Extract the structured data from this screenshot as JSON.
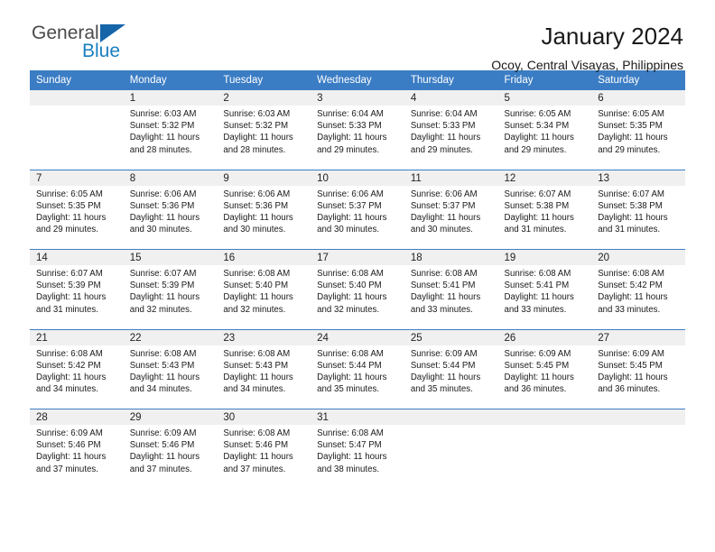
{
  "logo": {
    "word1": "General",
    "word2": "Blue",
    "triangle_color": "#1565a8",
    "blue_color": "#1a7fc1"
  },
  "header": {
    "title": "January 2024",
    "subtitle": "Ocoy, Central Visayas, Philippines"
  },
  "theme": {
    "header_bg": "#3b7dc4",
    "daynum_bg": "#f0f0f0",
    "cell_bg": "#ffffff"
  },
  "weekdays": [
    "Sunday",
    "Monday",
    "Tuesday",
    "Wednesday",
    "Thursday",
    "Friday",
    "Saturday"
  ],
  "weeks": [
    {
      "days": [
        {
          "num": "",
          "sunrise": "",
          "sunset": "",
          "daylight1": "",
          "daylight2": ""
        },
        {
          "num": "1",
          "sunrise": "Sunrise: 6:03 AM",
          "sunset": "Sunset: 5:32 PM",
          "daylight1": "Daylight: 11 hours",
          "daylight2": "and 28 minutes."
        },
        {
          "num": "2",
          "sunrise": "Sunrise: 6:03 AM",
          "sunset": "Sunset: 5:32 PM",
          "daylight1": "Daylight: 11 hours",
          "daylight2": "and 28 minutes."
        },
        {
          "num": "3",
          "sunrise": "Sunrise: 6:04 AM",
          "sunset": "Sunset: 5:33 PM",
          "daylight1": "Daylight: 11 hours",
          "daylight2": "and 29 minutes."
        },
        {
          "num": "4",
          "sunrise": "Sunrise: 6:04 AM",
          "sunset": "Sunset: 5:33 PM",
          "daylight1": "Daylight: 11 hours",
          "daylight2": "and 29 minutes."
        },
        {
          "num": "5",
          "sunrise": "Sunrise: 6:05 AM",
          "sunset": "Sunset: 5:34 PM",
          "daylight1": "Daylight: 11 hours",
          "daylight2": "and 29 minutes."
        },
        {
          "num": "6",
          "sunrise": "Sunrise: 6:05 AM",
          "sunset": "Sunset: 5:35 PM",
          "daylight1": "Daylight: 11 hours",
          "daylight2": "and 29 minutes."
        }
      ]
    },
    {
      "days": [
        {
          "num": "7",
          "sunrise": "Sunrise: 6:05 AM",
          "sunset": "Sunset: 5:35 PM",
          "daylight1": "Daylight: 11 hours",
          "daylight2": "and 29 minutes."
        },
        {
          "num": "8",
          "sunrise": "Sunrise: 6:06 AM",
          "sunset": "Sunset: 5:36 PM",
          "daylight1": "Daylight: 11 hours",
          "daylight2": "and 30 minutes."
        },
        {
          "num": "9",
          "sunrise": "Sunrise: 6:06 AM",
          "sunset": "Sunset: 5:36 PM",
          "daylight1": "Daylight: 11 hours",
          "daylight2": "and 30 minutes."
        },
        {
          "num": "10",
          "sunrise": "Sunrise: 6:06 AM",
          "sunset": "Sunset: 5:37 PM",
          "daylight1": "Daylight: 11 hours",
          "daylight2": "and 30 minutes."
        },
        {
          "num": "11",
          "sunrise": "Sunrise: 6:06 AM",
          "sunset": "Sunset: 5:37 PM",
          "daylight1": "Daylight: 11 hours",
          "daylight2": "and 30 minutes."
        },
        {
          "num": "12",
          "sunrise": "Sunrise: 6:07 AM",
          "sunset": "Sunset: 5:38 PM",
          "daylight1": "Daylight: 11 hours",
          "daylight2": "and 31 minutes."
        },
        {
          "num": "13",
          "sunrise": "Sunrise: 6:07 AM",
          "sunset": "Sunset: 5:38 PM",
          "daylight1": "Daylight: 11 hours",
          "daylight2": "and 31 minutes."
        }
      ]
    },
    {
      "days": [
        {
          "num": "14",
          "sunrise": "Sunrise: 6:07 AM",
          "sunset": "Sunset: 5:39 PM",
          "daylight1": "Daylight: 11 hours",
          "daylight2": "and 31 minutes."
        },
        {
          "num": "15",
          "sunrise": "Sunrise: 6:07 AM",
          "sunset": "Sunset: 5:39 PM",
          "daylight1": "Daylight: 11 hours",
          "daylight2": "and 32 minutes."
        },
        {
          "num": "16",
          "sunrise": "Sunrise: 6:08 AM",
          "sunset": "Sunset: 5:40 PM",
          "daylight1": "Daylight: 11 hours",
          "daylight2": "and 32 minutes."
        },
        {
          "num": "17",
          "sunrise": "Sunrise: 6:08 AM",
          "sunset": "Sunset: 5:40 PM",
          "daylight1": "Daylight: 11 hours",
          "daylight2": "and 32 minutes."
        },
        {
          "num": "18",
          "sunrise": "Sunrise: 6:08 AM",
          "sunset": "Sunset: 5:41 PM",
          "daylight1": "Daylight: 11 hours",
          "daylight2": "and 33 minutes."
        },
        {
          "num": "19",
          "sunrise": "Sunrise: 6:08 AM",
          "sunset": "Sunset: 5:41 PM",
          "daylight1": "Daylight: 11 hours",
          "daylight2": "and 33 minutes."
        },
        {
          "num": "20",
          "sunrise": "Sunrise: 6:08 AM",
          "sunset": "Sunset: 5:42 PM",
          "daylight1": "Daylight: 11 hours",
          "daylight2": "and 33 minutes."
        }
      ]
    },
    {
      "days": [
        {
          "num": "21",
          "sunrise": "Sunrise: 6:08 AM",
          "sunset": "Sunset: 5:42 PM",
          "daylight1": "Daylight: 11 hours",
          "daylight2": "and 34 minutes."
        },
        {
          "num": "22",
          "sunrise": "Sunrise: 6:08 AM",
          "sunset": "Sunset: 5:43 PM",
          "daylight1": "Daylight: 11 hours",
          "daylight2": "and 34 minutes."
        },
        {
          "num": "23",
          "sunrise": "Sunrise: 6:08 AM",
          "sunset": "Sunset: 5:43 PM",
          "daylight1": "Daylight: 11 hours",
          "daylight2": "and 34 minutes."
        },
        {
          "num": "24",
          "sunrise": "Sunrise: 6:08 AM",
          "sunset": "Sunset: 5:44 PM",
          "daylight1": "Daylight: 11 hours",
          "daylight2": "and 35 minutes."
        },
        {
          "num": "25",
          "sunrise": "Sunrise: 6:09 AM",
          "sunset": "Sunset: 5:44 PM",
          "daylight1": "Daylight: 11 hours",
          "daylight2": "and 35 minutes."
        },
        {
          "num": "26",
          "sunrise": "Sunrise: 6:09 AM",
          "sunset": "Sunset: 5:45 PM",
          "daylight1": "Daylight: 11 hours",
          "daylight2": "and 36 minutes."
        },
        {
          "num": "27",
          "sunrise": "Sunrise: 6:09 AM",
          "sunset": "Sunset: 5:45 PM",
          "daylight1": "Daylight: 11 hours",
          "daylight2": "and 36 minutes."
        }
      ]
    },
    {
      "days": [
        {
          "num": "28",
          "sunrise": "Sunrise: 6:09 AM",
          "sunset": "Sunset: 5:46 PM",
          "daylight1": "Daylight: 11 hours",
          "daylight2": "and 37 minutes."
        },
        {
          "num": "29",
          "sunrise": "Sunrise: 6:09 AM",
          "sunset": "Sunset: 5:46 PM",
          "daylight1": "Daylight: 11 hours",
          "daylight2": "and 37 minutes."
        },
        {
          "num": "30",
          "sunrise": "Sunrise: 6:08 AM",
          "sunset": "Sunset: 5:46 PM",
          "daylight1": "Daylight: 11 hours",
          "daylight2": "and 37 minutes."
        },
        {
          "num": "31",
          "sunrise": "Sunrise: 6:08 AM",
          "sunset": "Sunset: 5:47 PM",
          "daylight1": "Daylight: 11 hours",
          "daylight2": "and 38 minutes."
        },
        {
          "num": "",
          "sunrise": "",
          "sunset": "",
          "daylight1": "",
          "daylight2": ""
        },
        {
          "num": "",
          "sunrise": "",
          "sunset": "",
          "daylight1": "",
          "daylight2": ""
        },
        {
          "num": "",
          "sunrise": "",
          "sunset": "",
          "daylight1": "",
          "daylight2": ""
        }
      ]
    }
  ]
}
